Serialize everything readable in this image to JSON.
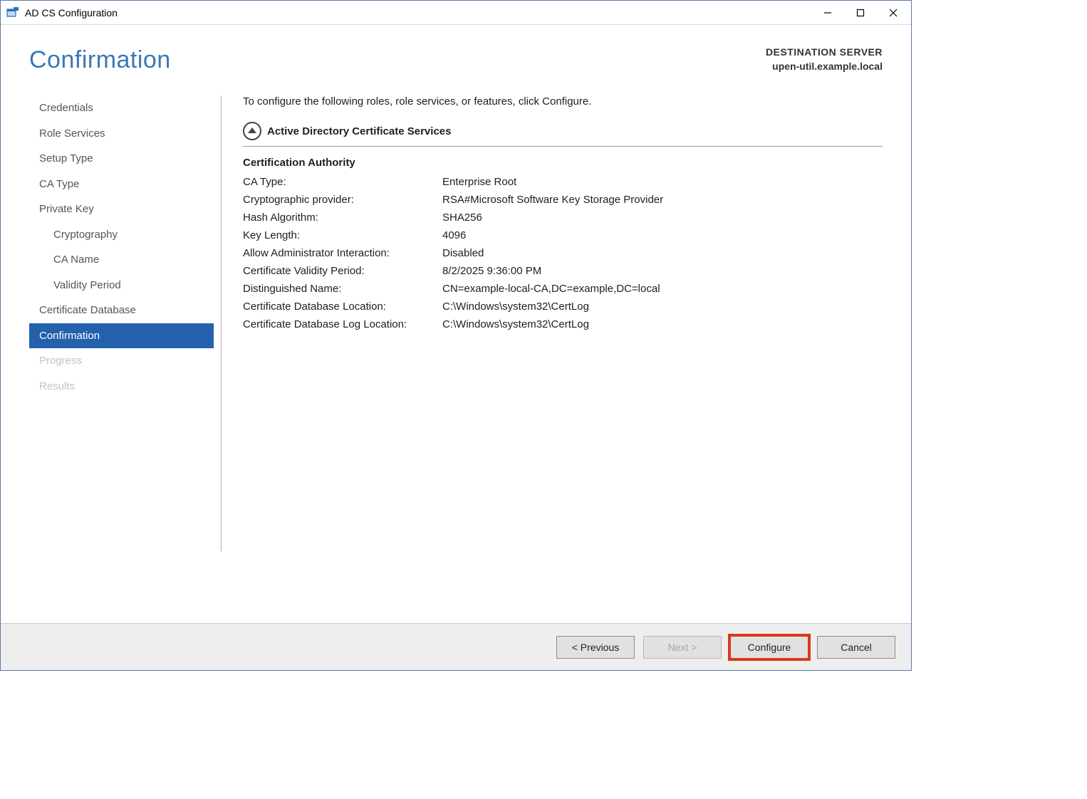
{
  "window": {
    "title": "AD CS Configuration"
  },
  "header": {
    "title": "Confirmation",
    "dest_label": "DESTINATION SERVER",
    "dest_server": "upen-util.example.local"
  },
  "sidebar": {
    "items": [
      {
        "label": "Credentials",
        "indent": false,
        "selected": false,
        "disabled": false
      },
      {
        "label": "Role Services",
        "indent": false,
        "selected": false,
        "disabled": false
      },
      {
        "label": "Setup Type",
        "indent": false,
        "selected": false,
        "disabled": false
      },
      {
        "label": "CA Type",
        "indent": false,
        "selected": false,
        "disabled": false
      },
      {
        "label": "Private Key",
        "indent": false,
        "selected": false,
        "disabled": false
      },
      {
        "label": "Cryptography",
        "indent": true,
        "selected": false,
        "disabled": false
      },
      {
        "label": "CA Name",
        "indent": true,
        "selected": false,
        "disabled": false
      },
      {
        "label": "Validity Period",
        "indent": true,
        "selected": false,
        "disabled": false
      },
      {
        "label": "Certificate Database",
        "indent": false,
        "selected": false,
        "disabled": false
      },
      {
        "label": "Confirmation",
        "indent": false,
        "selected": true,
        "disabled": false
      },
      {
        "label": "Progress",
        "indent": false,
        "selected": false,
        "disabled": true
      },
      {
        "label": "Results",
        "indent": false,
        "selected": false,
        "disabled": true
      }
    ]
  },
  "content": {
    "intro": "To configure the following roles, role services, or features, click Configure.",
    "section_title": "Active Directory Certificate Services",
    "sub_title": "Certification Authority",
    "rows": [
      {
        "k": "CA Type:",
        "v": "Enterprise Root"
      },
      {
        "k": "Cryptographic provider:",
        "v": "RSA#Microsoft Software Key Storage Provider"
      },
      {
        "k": "Hash Algorithm:",
        "v": "SHA256"
      },
      {
        "k": "Key Length:",
        "v": "4096"
      },
      {
        "k": "Allow Administrator Interaction:",
        "v": "Disabled"
      },
      {
        "k": "Certificate Validity Period:",
        "v": "8/2/2025 9:36:00 PM"
      },
      {
        "k": "Distinguished Name:",
        "v": "CN=example-local-CA,DC=example,DC=local"
      },
      {
        "k": "Certificate Database Location:",
        "v": "C:\\Windows\\system32\\CertLog"
      },
      {
        "k": "Certificate Database Log Location:",
        "v": "C:\\Windows\\system32\\CertLog"
      }
    ]
  },
  "footer": {
    "previous": "< Previous",
    "next": "Next >",
    "configure": "Configure",
    "cancel": "Cancel"
  }
}
